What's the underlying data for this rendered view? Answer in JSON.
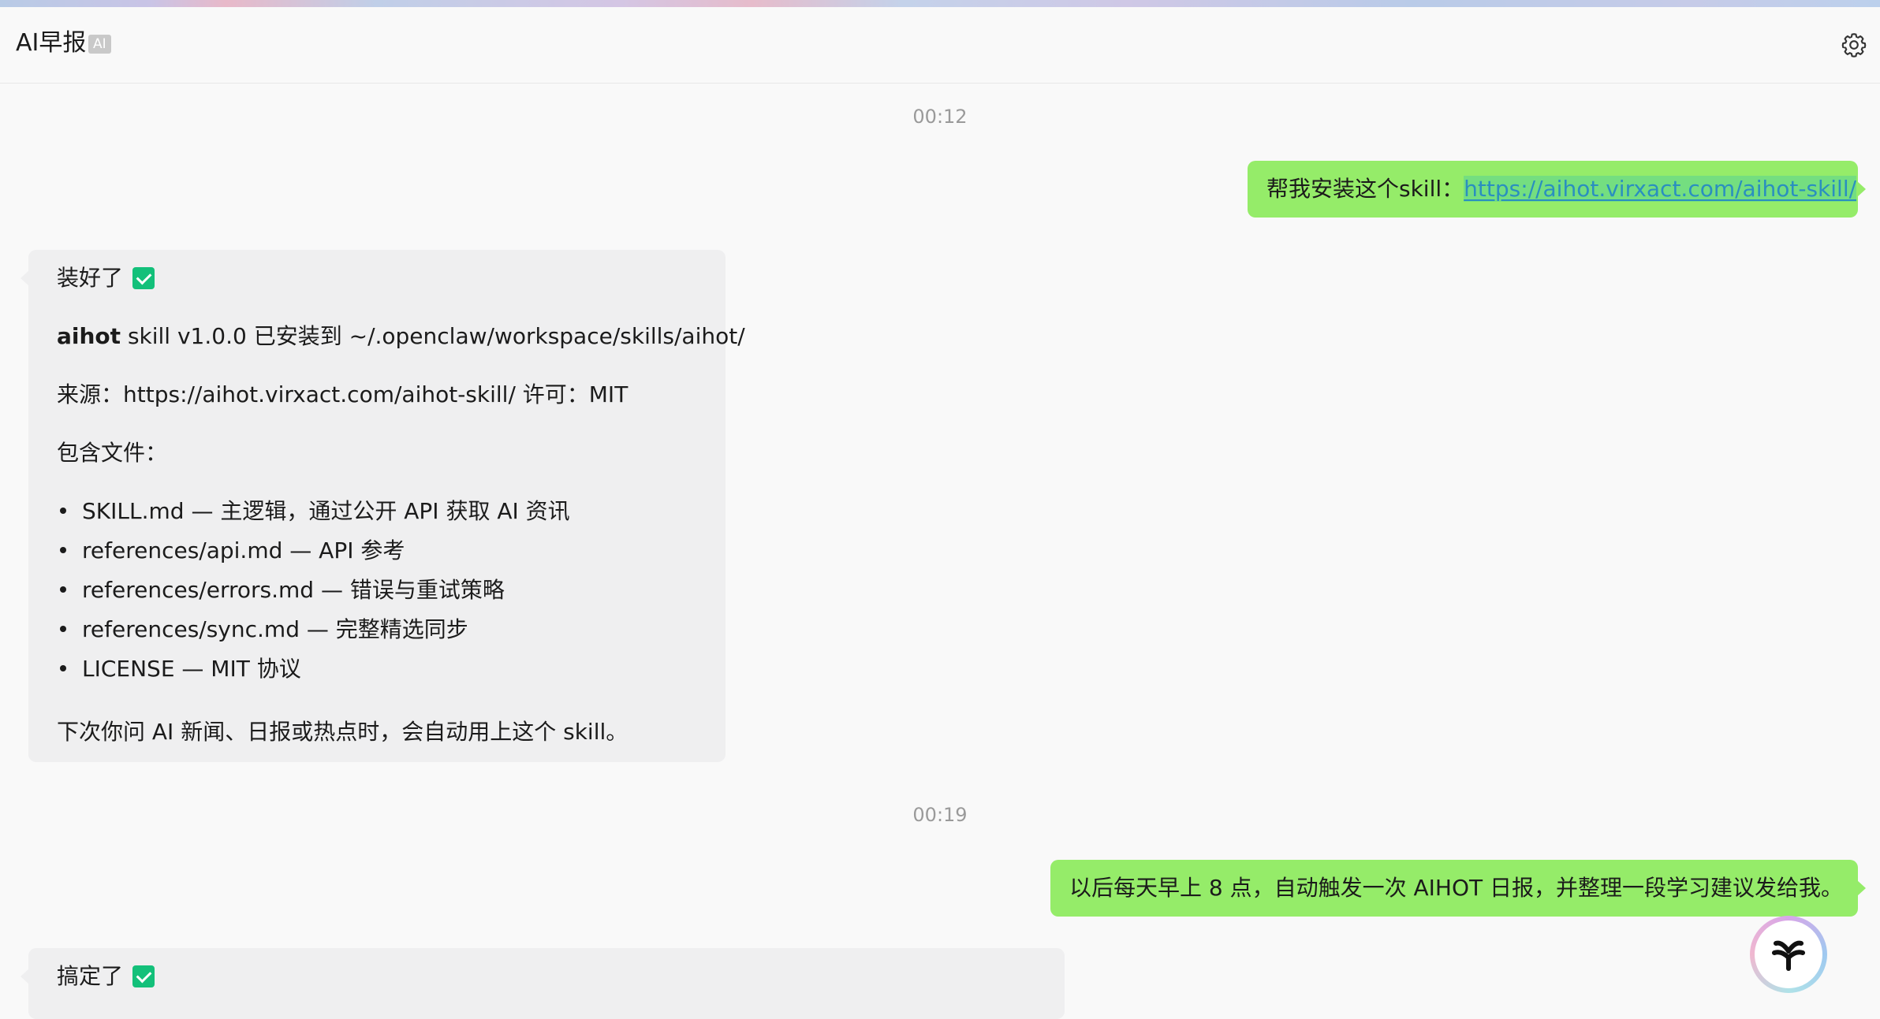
{
  "header": {
    "title": "AI早报",
    "badge": "AI",
    "settings_icon": "gear-icon"
  },
  "messages": [
    {
      "type": "timestamp",
      "text": "00:12"
    },
    {
      "type": "outgoing",
      "prefix": "帮我安装这个skill：",
      "link": "https://aihot.virxact.com/aihot-skill/"
    },
    {
      "type": "incoming",
      "heading": "装好了",
      "line1_bold": "aihot",
      "line1_rest": " skill v1.0.0 已安装到 ~/.openclaw/workspace/skills/aihot/",
      "line2": "来源：https://aihot.virxact.com/aihot-skill/ 许可：MIT",
      "line3": "包含文件：",
      "files": [
        "SKILL.md — 主逻辑，通过公开 API 获取 AI 资讯",
        "references/api.md — API 参考",
        "references/errors.md — 错误与重试策略",
        "references/sync.md — 完整精选同步",
        "LICENSE — MIT 协议"
      ],
      "footer": "下次你问 AI 新闻、日报或热点时，会自动用上这个 skill。"
    },
    {
      "type": "timestamp",
      "text": "00:19"
    },
    {
      "type": "outgoing",
      "text": "以后每天早上 8 点，自动触发一次 AIHOT 日报，并整理一段学习建议发给我。"
    },
    {
      "type": "incoming",
      "heading": "搞定了"
    }
  ],
  "icons": {
    "check": "check-icon",
    "assistant": "assistant-logo-icon"
  },
  "colors": {
    "outgoing_bubble": "#95ec69",
    "incoming_bubble": "#efeff0",
    "check": "#13c07a",
    "link": "#2a8fbf"
  }
}
